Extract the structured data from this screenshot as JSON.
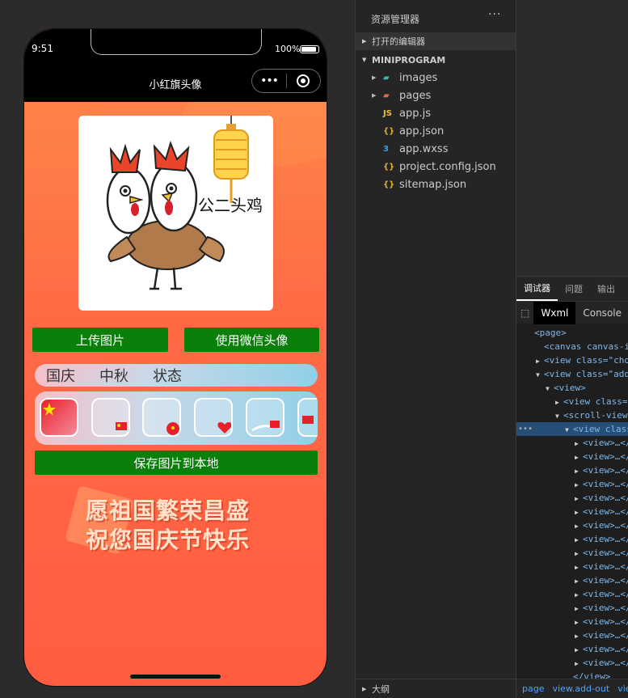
{
  "simulator": {
    "time": "9:51",
    "battery": "100%",
    "nav_title": "小红旗头像",
    "capsule_more": "•••",
    "upload_button": "上传图片",
    "wechat_avatar_button": "使用微信头像",
    "tabs": [
      "国庆",
      "中秋",
      "状态"
    ],
    "save_button": "保存图片到本地",
    "greeting_line1": "愿祖国繁荣昌盛",
    "greeting_line2": "祝您国庆节快乐",
    "avatar_caption": "公二头鸡"
  },
  "explorer": {
    "title": "资源管理器",
    "more": "···",
    "open_editors": "打开的编辑器",
    "project": "MINIPROGRAM",
    "items": [
      {
        "label": "images",
        "icon": "folder-images-icon",
        "expandable": true
      },
      {
        "label": "pages",
        "icon": "folder-pages-icon",
        "expandable": true
      },
      {
        "label": "app.js",
        "icon": "js-file-icon",
        "expandable": false
      },
      {
        "label": "app.json",
        "icon": "json-file-icon",
        "expandable": false
      },
      {
        "label": "app.wxss",
        "icon": "css-file-icon",
        "expandable": false
      },
      {
        "label": "project.config.json",
        "icon": "json-file-icon",
        "expandable": false
      },
      {
        "label": "sitemap.json",
        "icon": "json-file-icon",
        "expandable": false
      }
    ],
    "outline": "大纲"
  },
  "debugger": {
    "tabs": [
      "调试器",
      "问题",
      "输出"
    ],
    "sub_tabs": [
      "Wxml",
      "Console"
    ],
    "wxml_lines": [
      {
        "indent": 0,
        "tri": "",
        "text": "<page>"
      },
      {
        "indent": 1,
        "tri": "",
        "text": "<canvas canvas-id"
      },
      {
        "indent": 1,
        "tri": "▶",
        "text": "<view class=\"chose"
      },
      {
        "indent": 1,
        "tri": "▼",
        "text": "<view class=\"add-"
      },
      {
        "indent": 2,
        "tri": "▼",
        "text": "<view>"
      },
      {
        "indent": 3,
        "tri": "▶",
        "text": "<view class=\"a"
      },
      {
        "indent": 3,
        "tri": "▼",
        "text": "<scroll-view c"
      },
      {
        "indent": 4,
        "tri": "▼",
        "text": "<view class="
      },
      {
        "indent": 5,
        "tri": "▶",
        "text": "<view>…</v"
      },
      {
        "indent": 5,
        "tri": "▶",
        "text": "<view>…</v"
      },
      {
        "indent": 5,
        "tri": "▶",
        "text": "<view>…</v"
      },
      {
        "indent": 5,
        "tri": "▶",
        "text": "<view>…</v"
      },
      {
        "indent": 5,
        "tri": "▶",
        "text": "<view>…</v"
      },
      {
        "indent": 5,
        "tri": "▶",
        "text": "<view>…</v"
      },
      {
        "indent": 5,
        "tri": "▶",
        "text": "<view>…</v"
      },
      {
        "indent": 5,
        "tri": "▶",
        "text": "<view>…</v"
      },
      {
        "indent": 5,
        "tri": "▶",
        "text": "<view>…</v"
      },
      {
        "indent": 5,
        "tri": "▶",
        "text": "<view>…</v"
      },
      {
        "indent": 5,
        "tri": "▶",
        "text": "<view>…</v"
      },
      {
        "indent": 5,
        "tri": "▶",
        "text": "<view>…</v"
      },
      {
        "indent": 5,
        "tri": "▶",
        "text": "<view>…</v"
      },
      {
        "indent": 5,
        "tri": "▶",
        "text": "<view>…</v"
      },
      {
        "indent": 5,
        "tri": "▶",
        "text": "<view>…</v"
      },
      {
        "indent": 5,
        "tri": "▶",
        "text": "<view>…</v"
      },
      {
        "indent": 5,
        "tri": "▶",
        "text": "<view>…</v"
      },
      {
        "indent": 4,
        "tri": "",
        "text": "</view>"
      }
    ],
    "status_path": [
      "page",
      "view.add-out",
      "view"
    ]
  }
}
